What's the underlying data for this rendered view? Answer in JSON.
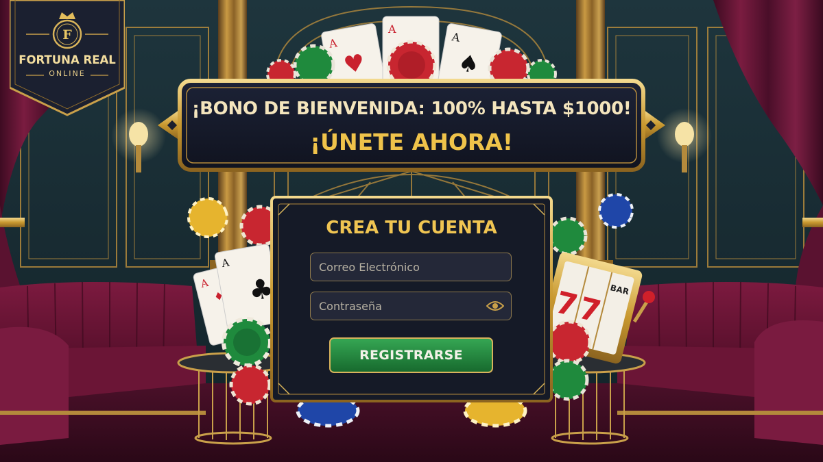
{
  "brand": {
    "line1": "FORTUNA REAL",
    "line2": "ONLINE",
    "initial": "F"
  },
  "promo": {
    "line1": "¡BONO DE BIENVENIDA: 100% HASTA $1000!",
    "line2": "¡ÚNETE AHORA!"
  },
  "signup": {
    "title": "CREA TU CUENTA",
    "email_placeholder": "Correo Electrónico",
    "password_placeholder": "Contraseña",
    "submit_label": "REGISTRARSE"
  },
  "playing_cards": {
    "top_left": "A",
    "top_center": "A",
    "top_right": "A",
    "left_front": "A",
    "left_back": "A"
  },
  "slot_machine": {
    "reel1": "7",
    "reel2": "7",
    "reel3": "BAR"
  },
  "colors": {
    "gold": "#d9b45a",
    "gold_text": "#efc34a",
    "panel": "#151a27",
    "button_green": "#2e9a4c",
    "velvet": "#6e1a39",
    "wall": "#1b3038"
  }
}
